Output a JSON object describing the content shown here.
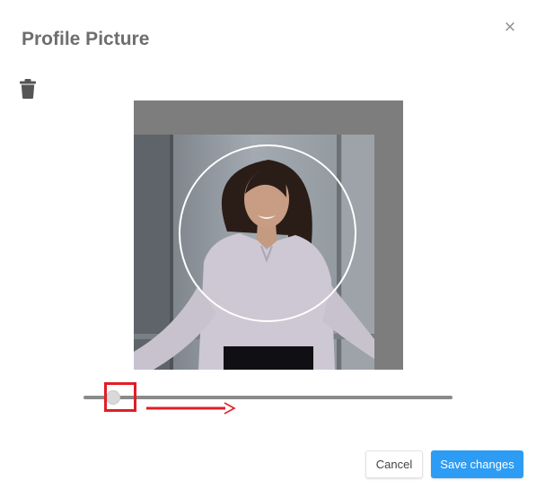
{
  "dialog": {
    "title": "Profile Picture",
    "close_glyph": "×",
    "delete_icon": "trash-icon"
  },
  "cropper": {
    "zoom_level": 0.08
  },
  "annotation": {
    "highlight_color": "#e01e25",
    "arrow_icon": "arrow-right-icon"
  },
  "footer": {
    "cancel_label": "Cancel",
    "save_label": "Save changes",
    "save_color": "#2d9cf4"
  }
}
